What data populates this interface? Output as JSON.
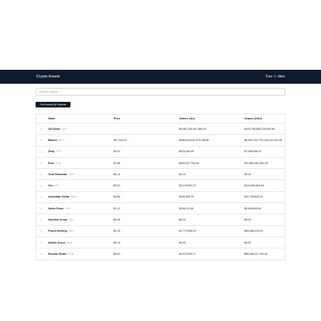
{
  "navbar": {
    "title": "Crypto Assets",
    "favorites_label_a": "Fav",
    "favorites_label_b": "rites"
  },
  "search": {
    "placeholder": "Search Assets",
    "value": ""
  },
  "sort_button": {
    "label": "Sort Assets By Favorite"
  },
  "table": {
    "headers": [
      "Name",
      "Price",
      "Volume (1hr)",
      "Volume (24hr)"
    ],
    "rows": [
      {
        "name": "US Dollar",
        "code": "USD",
        "price": "",
        "vol1h": "$3,481,135,641,880.09",
        "vol24h": "$105,756,556,126,540.96"
      },
      {
        "name": "Bitcoin",
        "code": "BTC",
        "price": "$37,344.67",
        "vol1h": "$288,094,540,573,148.80",
        "vol24h": "$6,689,792,776,135,242,000.00"
      },
      {
        "name": "Zloty",
        "code": "PLN",
        "price": "$0.23",
        "vol1h": "$216,280.56",
        "vol24h": "$7,988,358.00"
      },
      {
        "name": "Euro",
        "code": "EUR",
        "price": "$1.06",
        "vol1h": "$363,537,796.94",
        "vol24h": "$10,861,292,000.93"
      },
      {
        "name": "Yuan Renminbi",
        "code": "CNY",
        "price": "$0.14",
        "vol1h": "$0.00",
        "vol24h": "$0.00"
      },
      {
        "name": "Yen",
        "code": "JPY",
        "price": "$0.01",
        "vol1h": "$5,176,831.22",
        "vol24h": "$110,859,818.04"
      },
      {
        "name": "Australian Dollar",
        "code": "AUD",
        "price": "$0.64",
        "vol1h": "$336,028.78",
        "vol24h": "$10,735,623.24"
      },
      {
        "name": "Swiss Franc",
        "code": "CHF",
        "price": "$1.11",
        "vol1h": "$298,112.96",
        "vol24h": "$5,408,809.40"
      },
      {
        "name": "Swedish Krona",
        "code": "SEK",
        "price": "$0.09",
        "vol1h": "$0.00",
        "vol24h": "$0.00"
      },
      {
        "name": "Pound Sterling",
        "code": "GBP",
        "price": "$1.23",
        "vol1h": "$1,770,598.09",
        "vol24h": "$68,986,915.00"
      },
      {
        "name": "Danish Krone",
        "code": "DKK",
        "price": "$0.14",
        "vol1h": "$0.00",
        "vol24h": "$0.00"
      },
      {
        "name": "Russian Ruble",
        "code": "RUB",
        "price": "$0.01",
        "vol1h": "$6,575,053.17",
        "vol24h": "$96,066,227,484.61"
      }
    ]
  },
  "icons": {
    "favorite": "star-outline-icon",
    "row_favorite": "star-outline-icon"
  },
  "colors": {
    "navbar_bg": "#111a2b",
    "button_bg": "#111a2b",
    "border": "#e5e7eb"
  }
}
